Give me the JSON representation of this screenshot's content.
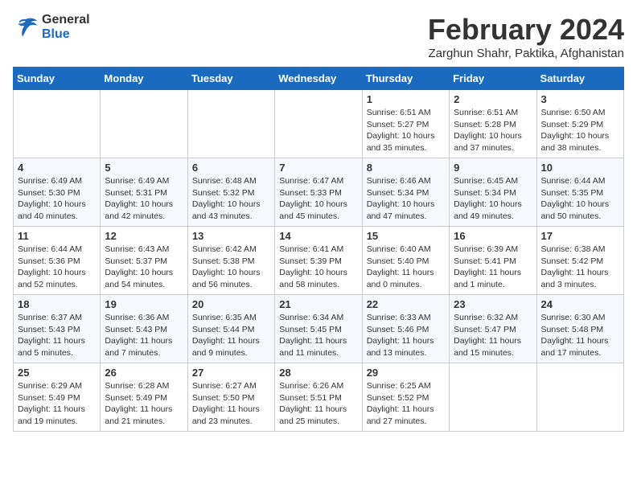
{
  "header": {
    "logo_general": "General",
    "logo_blue": "Blue",
    "month_title": "February 2024",
    "location": "Zarghun Shahr, Paktika, Afghanistan"
  },
  "days_of_week": [
    "Sunday",
    "Monday",
    "Tuesday",
    "Wednesday",
    "Thursday",
    "Friday",
    "Saturday"
  ],
  "weeks": [
    [
      {
        "day": "",
        "info": ""
      },
      {
        "day": "",
        "info": ""
      },
      {
        "day": "",
        "info": ""
      },
      {
        "day": "",
        "info": ""
      },
      {
        "day": "1",
        "info": "Sunrise: 6:51 AM\nSunset: 5:27 PM\nDaylight: 10 hours\nand 35 minutes."
      },
      {
        "day": "2",
        "info": "Sunrise: 6:51 AM\nSunset: 5:28 PM\nDaylight: 10 hours\nand 37 minutes."
      },
      {
        "day": "3",
        "info": "Sunrise: 6:50 AM\nSunset: 5:29 PM\nDaylight: 10 hours\nand 38 minutes."
      }
    ],
    [
      {
        "day": "4",
        "info": "Sunrise: 6:49 AM\nSunset: 5:30 PM\nDaylight: 10 hours\nand 40 minutes."
      },
      {
        "day": "5",
        "info": "Sunrise: 6:49 AM\nSunset: 5:31 PM\nDaylight: 10 hours\nand 42 minutes."
      },
      {
        "day": "6",
        "info": "Sunrise: 6:48 AM\nSunset: 5:32 PM\nDaylight: 10 hours\nand 43 minutes."
      },
      {
        "day": "7",
        "info": "Sunrise: 6:47 AM\nSunset: 5:33 PM\nDaylight: 10 hours\nand 45 minutes."
      },
      {
        "day": "8",
        "info": "Sunrise: 6:46 AM\nSunset: 5:34 PM\nDaylight: 10 hours\nand 47 minutes."
      },
      {
        "day": "9",
        "info": "Sunrise: 6:45 AM\nSunset: 5:34 PM\nDaylight: 10 hours\nand 49 minutes."
      },
      {
        "day": "10",
        "info": "Sunrise: 6:44 AM\nSunset: 5:35 PM\nDaylight: 10 hours\nand 50 minutes."
      }
    ],
    [
      {
        "day": "11",
        "info": "Sunrise: 6:44 AM\nSunset: 5:36 PM\nDaylight: 10 hours\nand 52 minutes."
      },
      {
        "day": "12",
        "info": "Sunrise: 6:43 AM\nSunset: 5:37 PM\nDaylight: 10 hours\nand 54 minutes."
      },
      {
        "day": "13",
        "info": "Sunrise: 6:42 AM\nSunset: 5:38 PM\nDaylight: 10 hours\nand 56 minutes."
      },
      {
        "day": "14",
        "info": "Sunrise: 6:41 AM\nSunset: 5:39 PM\nDaylight: 10 hours\nand 58 minutes."
      },
      {
        "day": "15",
        "info": "Sunrise: 6:40 AM\nSunset: 5:40 PM\nDaylight: 11 hours\nand 0 minutes."
      },
      {
        "day": "16",
        "info": "Sunrise: 6:39 AM\nSunset: 5:41 PM\nDaylight: 11 hours\nand 1 minute."
      },
      {
        "day": "17",
        "info": "Sunrise: 6:38 AM\nSunset: 5:42 PM\nDaylight: 11 hours\nand 3 minutes."
      }
    ],
    [
      {
        "day": "18",
        "info": "Sunrise: 6:37 AM\nSunset: 5:43 PM\nDaylight: 11 hours\nand 5 minutes."
      },
      {
        "day": "19",
        "info": "Sunrise: 6:36 AM\nSunset: 5:43 PM\nDaylight: 11 hours\nand 7 minutes."
      },
      {
        "day": "20",
        "info": "Sunrise: 6:35 AM\nSunset: 5:44 PM\nDaylight: 11 hours\nand 9 minutes."
      },
      {
        "day": "21",
        "info": "Sunrise: 6:34 AM\nSunset: 5:45 PM\nDaylight: 11 hours\nand 11 minutes."
      },
      {
        "day": "22",
        "info": "Sunrise: 6:33 AM\nSunset: 5:46 PM\nDaylight: 11 hours\nand 13 minutes."
      },
      {
        "day": "23",
        "info": "Sunrise: 6:32 AM\nSunset: 5:47 PM\nDaylight: 11 hours\nand 15 minutes."
      },
      {
        "day": "24",
        "info": "Sunrise: 6:30 AM\nSunset: 5:48 PM\nDaylight: 11 hours\nand 17 minutes."
      }
    ],
    [
      {
        "day": "25",
        "info": "Sunrise: 6:29 AM\nSunset: 5:49 PM\nDaylight: 11 hours\nand 19 minutes."
      },
      {
        "day": "26",
        "info": "Sunrise: 6:28 AM\nSunset: 5:49 PM\nDaylight: 11 hours\nand 21 minutes."
      },
      {
        "day": "27",
        "info": "Sunrise: 6:27 AM\nSunset: 5:50 PM\nDaylight: 11 hours\nand 23 minutes."
      },
      {
        "day": "28",
        "info": "Sunrise: 6:26 AM\nSunset: 5:51 PM\nDaylight: 11 hours\nand 25 minutes."
      },
      {
        "day": "29",
        "info": "Sunrise: 6:25 AM\nSunset: 5:52 PM\nDaylight: 11 hours\nand 27 minutes."
      },
      {
        "day": "",
        "info": ""
      },
      {
        "day": "",
        "info": ""
      }
    ]
  ]
}
